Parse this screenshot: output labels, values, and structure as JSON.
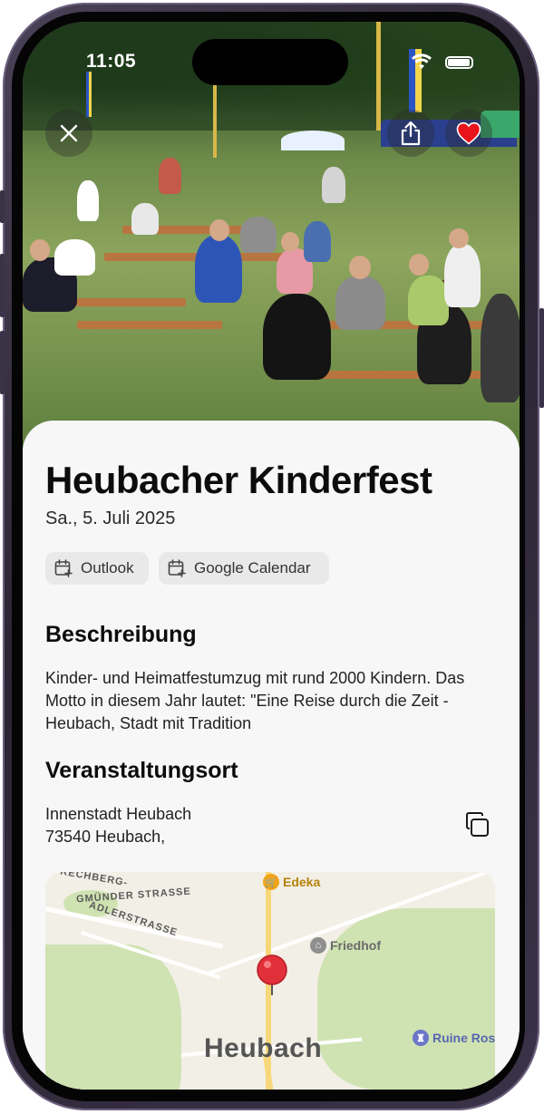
{
  "status_bar": {
    "time": "11:05"
  },
  "event": {
    "title": "Heubacher Kinderfest",
    "date": "Sa., 5. Juli 2025",
    "calendar_buttons": [
      {
        "label": "Outlook"
      },
      {
        "label": "Google Calendar"
      }
    ],
    "description_heading": "Beschreibung",
    "description": "Kinder- und Heimatfestumzug mit rund 2000 Kindern. Das Motto in diesem Jahr lautet: \"Eine Reise durch die Zeit - Heubach, Stadt mit Tradition",
    "location_heading": "Veranstaltungsort",
    "address_line1": "Innenstadt Heubach",
    "address_line2": "73540 Heubach,"
  },
  "map": {
    "streets": [
      "RECHBERG-",
      "GMÜNDER STRASSE",
      "ADLERSTRASSE"
    ],
    "pois": [
      "Edeka",
      "Friedhof",
      "Ruine Rosenstein"
    ],
    "city": "Heubach"
  },
  "colors": {
    "favorite": "#e8141b",
    "sheet_bg": "#f7f7f7",
    "chip_bg": "#e9e9e9"
  },
  "icons": [
    "close-icon",
    "share-icon",
    "heart-icon",
    "calendar-add-icon",
    "copy-icon",
    "map-pin-icon"
  ]
}
